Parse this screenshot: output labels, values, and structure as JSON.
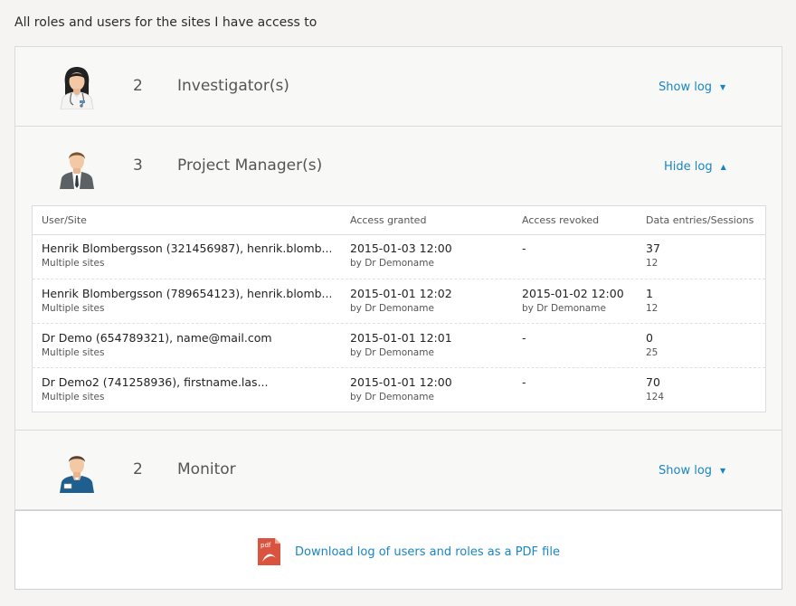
{
  "page": {
    "title": "All roles and users for the sites I have access to"
  },
  "roles": [
    {
      "count": "2",
      "name": "Investigator(s)",
      "toggle_label": "Show log",
      "icon": "doctor-female-icon"
    },
    {
      "count": "3",
      "name": "Project Manager(s)",
      "toggle_label": "Hide log",
      "icon": "manager-male-icon"
    },
    {
      "count": "2",
      "name": "Monitor",
      "toggle_label": "Show log",
      "icon": "monitor-male-icon"
    }
  ],
  "log_table": {
    "columns": [
      "User/Site",
      "Access granted",
      "Access revoked",
      "Data entries/Sessions"
    ],
    "rows": [
      {
        "user": "Henrik Blombergsson (321456987), henrik.blomb...",
        "site": "Multiple sites",
        "granted": "2015-01-03 12:00",
        "granted_by": "by Dr Demoname",
        "revoked": "-",
        "revoked_by": "",
        "entries": "37",
        "sessions": "12"
      },
      {
        "user": "Henrik Blombergsson (789654123), henrik.blomb...",
        "site": "Multiple sites",
        "granted": "2015-01-01 12:02",
        "granted_by": "by Dr Demoname",
        "revoked": "2015-01-02 12:00",
        "revoked_by": "by Dr Demoname",
        "entries": "1",
        "sessions": "12"
      },
      {
        "user": "Dr Demo (654789321), name@mail.com",
        "site": "Multiple sites",
        "granted": "2015-01-01 12:01",
        "granted_by": "by Dr Demoname",
        "revoked": "-",
        "revoked_by": "",
        "entries": "0",
        "sessions": "25"
      },
      {
        "user": "Dr Demo2 (741258936), firstname.las...",
        "site": "Multiple sites",
        "granted": "2015-01-01 12:00",
        "granted_by": "by Dr Demoname",
        "revoked": "-",
        "revoked_by": "",
        "entries": "70",
        "sessions": "124"
      }
    ]
  },
  "download": {
    "label": "Download log of users and roles as a PDF file",
    "icon": "pdf-file-icon"
  },
  "colors": {
    "link": "#1a85c2",
    "pdf": "#d9533f",
    "background": "#f5f4f3"
  }
}
